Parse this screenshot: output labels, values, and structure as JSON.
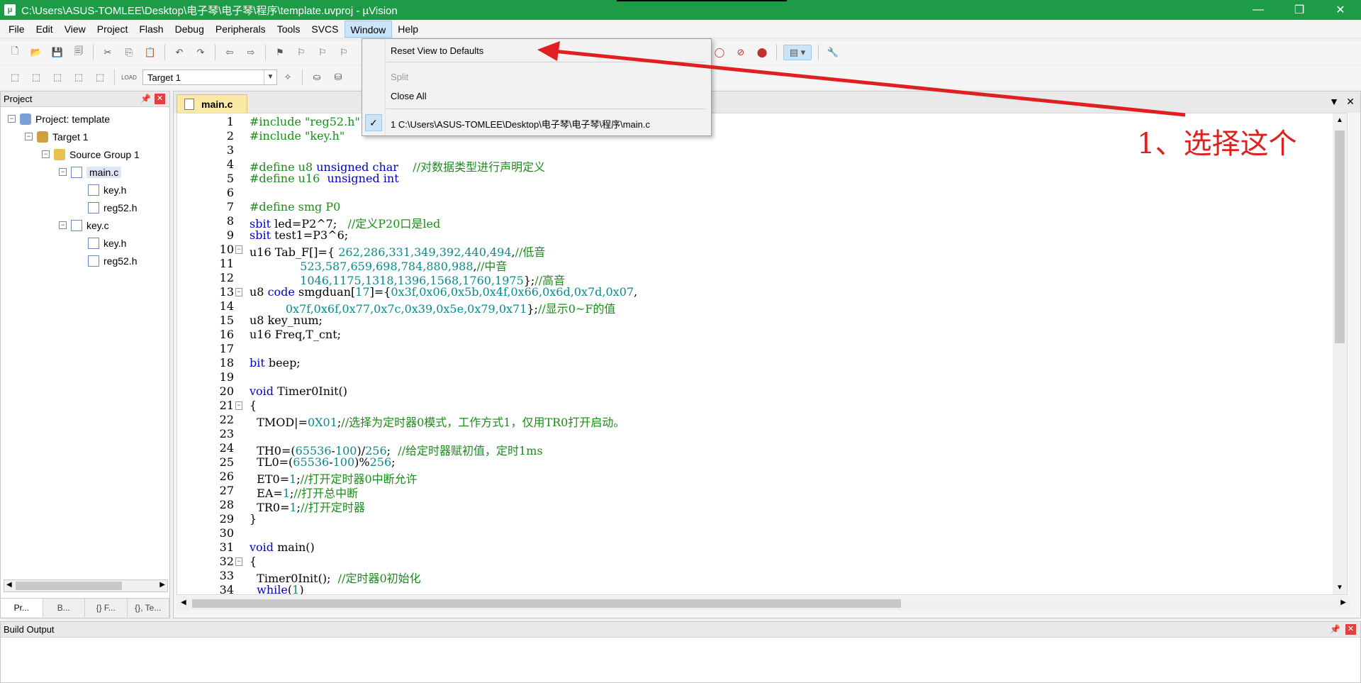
{
  "window": {
    "title": "C:\\Users\\ASUS-TOMLEE\\Desktop\\电子琴\\电子琴\\程序\\template.uvproj - µVision",
    "minimize": "—",
    "restore": "❐",
    "close": "✕"
  },
  "menu": [
    "File",
    "Edit",
    "View",
    "Project",
    "Flash",
    "Debug",
    "Peripherals",
    "Tools",
    "SVCS",
    "Window",
    "Help"
  ],
  "active_menu": "Window",
  "window_menu": {
    "reset": "Reset View to Defaults",
    "split": "Split",
    "close_all": "Close All",
    "recent": "1 C:\\Users\\ASUS-TOMLEE\\Desktop\\电子琴\\电子琴\\程序\\main.c",
    "check": "✓"
  },
  "toolbar": {
    "target": "Target 1",
    "load_label": "LOAD"
  },
  "project_panel": {
    "title": "Project",
    "pin": "📌",
    "close": "✕",
    "tree": [
      {
        "label": "Project: template",
        "indent": 0,
        "exp": "−",
        "icon": "proj"
      },
      {
        "label": "Target 1",
        "indent": 1,
        "exp": "−",
        "icon": "target"
      },
      {
        "label": "Source Group 1",
        "indent": 2,
        "exp": "−",
        "icon": "folder"
      },
      {
        "label": "main.c",
        "indent": 3,
        "exp": "−",
        "icon": "file",
        "selected": true
      },
      {
        "label": "key.h",
        "indent": 4,
        "exp": "",
        "icon": "file"
      },
      {
        "label": "reg52.h",
        "indent": 4,
        "exp": "",
        "icon": "file"
      },
      {
        "label": "key.c",
        "indent": 3,
        "exp": "−",
        "icon": "file"
      },
      {
        "label": "key.h",
        "indent": 4,
        "exp": "",
        "icon": "file"
      },
      {
        "label": "reg52.h",
        "indent": 4,
        "exp": "",
        "icon": "file"
      }
    ],
    "tabs": [
      "Pr...",
      "B...",
      "{} F...",
      "{}, Te..."
    ]
  },
  "editor": {
    "tab": "main.c",
    "lines": [
      {
        "n": "1",
        "html": "<span class='c-pp'>#include \"reg52.h\"</span>"
      },
      {
        "n": "2",
        "html": "<span class='c-pp'>#include \"key.h\"</span>"
      },
      {
        "n": "3",
        "html": ""
      },
      {
        "n": "4",
        "html": "<span class='c-pp'>#define u8 </span><span class='c-kw'>unsigned char</span>    <span class='c-cm'>//对数据类型进行声明定义</span>"
      },
      {
        "n": "5",
        "html": "<span class='c-pp'>#define u16  </span><span class='c-kw'>unsigned int</span>"
      },
      {
        "n": "6",
        "html": ""
      },
      {
        "n": "7",
        "html": "<span class='c-pp'>#define smg P0</span>"
      },
      {
        "n": "8",
        "html": "<span class='c-kw'>sbit</span> led=P2^7;   <span class='c-cm'>//定义P20口是led</span>"
      },
      {
        "n": "9",
        "html": "<span class='c-kw'>sbit</span> test1=P3^6;"
      },
      {
        "n": "10",
        "fold": "−",
        "html": "u16 Tab_F[]={ <span class='c-num'>262,286,331,349,392,440,494</span>,<span class='c-cm'>//低音</span>"
      },
      {
        "n": "11",
        "html": "              <span class='c-num'>523,587,659,698,784,880,988</span>,<span class='c-cm'>//中音</span>"
      },
      {
        "n": "12",
        "html": "              <span class='c-num'>1046,1175,1318,1396,1568,1760,1975</span>};<span class='c-cm'>//高音</span>"
      },
      {
        "n": "13",
        "fold": "−",
        "html": "u8 <span class='c-kw'>code</span> smgduan[<span class='c-num'>17</span>]={<span class='c-num'>0x3f,0x06,0x5b,0x4f,0x66,0x6d,0x7d,0x07</span>,"
      },
      {
        "n": "14",
        "html": "          <span class='c-num'>0x7f,0x6f,0x77,0x7c,0x39,0x5e,0x79,0x71</span>};<span class='c-cm'>//显示0~F的值</span>"
      },
      {
        "n": "15",
        "html": "u8 key_num;"
      },
      {
        "n": "16",
        "html": "u16 Freq,T_cnt;"
      },
      {
        "n": "17",
        "html": ""
      },
      {
        "n": "18",
        "html": "<span class='c-kw'>bit</span> beep;"
      },
      {
        "n": "19",
        "html": ""
      },
      {
        "n": "20",
        "html": "<span class='c-kw'>void</span> Timer0Init()"
      },
      {
        "n": "21",
        "fold": "−",
        "html": "{"
      },
      {
        "n": "22",
        "html": "  TMOD|=<span class='c-num'>0X01</span>;<span class='c-cm'>//选择为定时器0模式，工作方式1，仅用TR0打开启动。</span>"
      },
      {
        "n": "23",
        "html": ""
      },
      {
        "n": "24",
        "html": "  TH0=(<span class='c-num'>65536</span>-<span class='c-num'>100</span>)/<span class='c-num'>256</span>;  <span class='c-cm'>//给定时器赋初值，定时1ms</span>"
      },
      {
        "n": "25",
        "html": "  TL0=(<span class='c-num'>65536</span>-<span class='c-num'>100</span>)%<span class='c-num'>256</span>;"
      },
      {
        "n": "26",
        "html": "  ET0=<span class='c-num'>1</span>;<span class='c-cm'>//打开定时器0中断允许</span>"
      },
      {
        "n": "27",
        "html": "  EA=<span class='c-num'>1</span>;<span class='c-cm'>//打开总中断</span>"
      },
      {
        "n": "28",
        "html": "  TR0=<span class='c-num'>1</span>;<span class='c-cm'>//打开定时器</span>"
      },
      {
        "n": "29",
        "html": "}"
      },
      {
        "n": "30",
        "html": ""
      },
      {
        "n": "31",
        "html": "<span class='c-kw'>void</span> main()"
      },
      {
        "n": "32",
        "fold": "−",
        "html": "{"
      },
      {
        "n": "33",
        "html": "  Timer0Init();  <span class='c-cm'>//定时器0初始化</span>"
      },
      {
        "n": "34",
        "html": "  <span class='c-kw'>while</span>(<span class='c-num'>1</span>)"
      }
    ]
  },
  "build_output": {
    "title": "Build Output",
    "pin": "📌",
    "close": "✕"
  },
  "annotation": {
    "text": "1、选择这个",
    "color": "#e02020"
  },
  "colors": {
    "titlebar": "#1e9b46",
    "menu_highlight": "#cce4f7"
  }
}
